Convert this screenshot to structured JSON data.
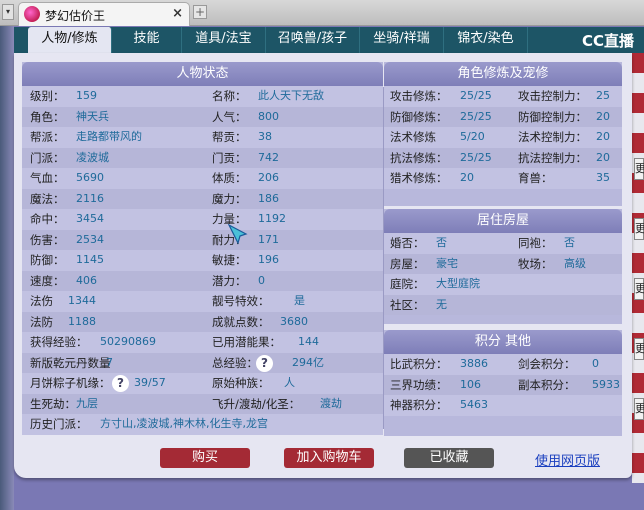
{
  "browser": {
    "tab_title": "梦幻估价王",
    "close": "×",
    "new_tab": "+"
  },
  "nav": {
    "tabs": [
      "人物/修炼",
      "技能",
      "道具/法宝",
      "召唤兽/孩子",
      "坐骑/祥瑞",
      "锦衣/染色"
    ],
    "watermark": "CC直播"
  },
  "status": {
    "title": "人物状态",
    "rows": [
      [
        "级别：",
        "159",
        "名称：",
        "此人天下无敌"
      ],
      [
        "角色：",
        "神天兵",
        "人气：",
        "800"
      ],
      [
        "帮派：",
        "走路都带风的",
        "帮贡：",
        "38"
      ],
      [
        "门派：",
        "凌波城",
        "门贡：",
        "742"
      ],
      [
        "气血：",
        "5690",
        "体质：",
        "206"
      ],
      [
        "魔法：",
        "2116",
        "魔力：",
        "186"
      ],
      [
        "命中：",
        "3454",
        "力量：",
        "1192"
      ],
      [
        "伤害：",
        "2534",
        "耐力：",
        "171"
      ],
      [
        "防御：",
        "1145",
        "敏捷：",
        "196"
      ],
      [
        "速度：",
        "406",
        "潜力：",
        "0"
      ],
      [
        "法伤",
        "1344",
        "靓号特效：",
        "是"
      ],
      [
        "法防",
        "1188",
        "成就点数：",
        "3680"
      ],
      [
        "获得经验：",
        "50290869",
        "已用潜能果：",
        "144"
      ],
      [
        "新版乾元丹数量",
        "7",
        "总经验：",
        "294亿"
      ],
      [
        "月饼粽子机缘：",
        "39/57",
        "原始种族：",
        "人"
      ],
      [
        "生死劫：",
        "九层",
        "飞升/渡劫/化圣：",
        "渡劫"
      ]
    ],
    "history_label": "历史门派：",
    "history_value": "方寸山,凌波城,神木林,化生寺,龙宫",
    "help": "?"
  },
  "cultivation": {
    "title": "角色修炼及宠修",
    "rows": [
      [
        "攻击修炼：",
        "25/25",
        "攻击控制力：",
        "25"
      ],
      [
        "防御修炼：",
        "25/25",
        "防御控制力：",
        "20"
      ],
      [
        "法术修炼",
        "5/20",
        "法术控制力：",
        "20"
      ],
      [
        "抗法修炼：",
        "25/25",
        "抗法控制力：",
        "20"
      ],
      [
        "猎术修炼：",
        "20",
        "育兽：",
        "35"
      ]
    ]
  },
  "house": {
    "title": "居住房屋",
    "rows": [
      [
        "婚否：",
        "否",
        "同袍：",
        "否"
      ],
      [
        "房屋：",
        "豪宅",
        "牧场：",
        "高级"
      ],
      [
        "庭院：",
        "大型庭院",
        "",
        ""
      ],
      [
        "社区：",
        "无",
        "",
        ""
      ]
    ]
  },
  "score": {
    "title": "积分 其他",
    "rows": [
      [
        "比武积分：",
        "3886",
        "剑会积分：",
        "0"
      ],
      [
        "三界功绩：",
        "106",
        "副本积分：",
        "5933"
      ],
      [
        "神器积分：",
        "5463",
        "",
        ""
      ]
    ]
  },
  "actions": {
    "buy": "购买",
    "add_cart": "加入购物车",
    "favorited": "已收藏",
    "web_version": "使用网页版"
  },
  "side": {
    "more": "更"
  }
}
